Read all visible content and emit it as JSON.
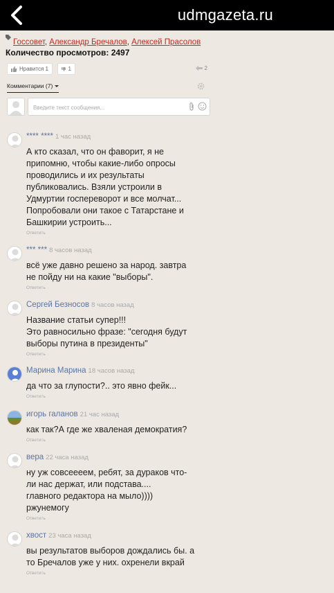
{
  "header": {
    "title": "udmgazeta.ru"
  },
  "tags": [
    "Госсовет",
    "Александр Бречалов",
    "Алексей Прасолов"
  ],
  "views": {
    "label": "Количество просмотров:",
    "count": "2497"
  },
  "actions": {
    "like_label": "Нравится 1",
    "dislike_count": "1",
    "share_count": "2"
  },
  "comments_tab": "Комментарии (7)",
  "compose": {
    "placeholder": "Введите текст сообщения..."
  },
  "reply_label": "Ответить",
  "comments": [
    {
      "author": "**** ****",
      "time": "1 час назад",
      "avatar": "default",
      "lines": [
        "А кто сказал, что он фаворит, я не",
        "припомню, чтобы какие-либо опросы",
        "проводились и их результаты",
        "публиковались. Взяли устроили в",
        "Удмуртии госпереворот и все молчат...",
        "Попробовали они такое с Татарстане и",
        "Башкирии устроить..."
      ]
    },
    {
      "author": "*** ***",
      "time": "8 часов назад",
      "avatar": "default",
      "lines": [
        "всё уже давно решено за народ. завтра",
        "не пойду ни на какие \"выборы\"."
      ]
    },
    {
      "author": "Сергей Безносов",
      "time": "8 часов назад",
      "avatar": "default",
      "lines": [
        "Название статьи супер!!!",
        "Это равносильно фразе: \"сегодня будут",
        "выборы путина в президенты\""
      ]
    },
    {
      "author": "Марина Марина",
      "time": "18 часов назад",
      "avatar": "blue",
      "lines": [
        "да что за глупости?.. это явно фейк..."
      ]
    },
    {
      "author": "игорь галанов",
      "time": "21 час назад",
      "avatar": "photo",
      "lines": [
        "как так?А где же хваленая демократия?"
      ]
    },
    {
      "author": "вера",
      "time": "22 часа назад",
      "avatar": "default",
      "lines": [
        "ну уж совсеееем, ребят, за дураков что-",
        "ли нас держат, или подстава....",
        "главного редактора на мыло))))",
        "ржунемогу"
      ]
    },
    {
      "author": "хвост",
      "time": "23 часа назад",
      "avatar": "default",
      "lines": [
        "вы результатов выборов дождались бы. а",
        "то Бречалов уже у них. охренели вкрай"
      ]
    }
  ]
}
